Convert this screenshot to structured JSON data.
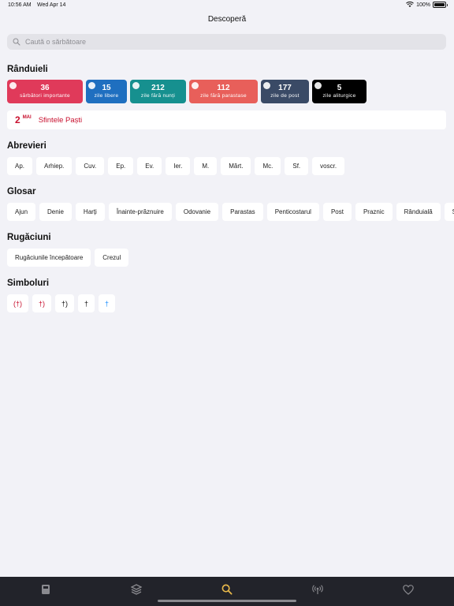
{
  "status_bar": {
    "time": "10:56 AM",
    "date": "Wed Apr 14",
    "battery": "100%"
  },
  "title": "Descoperă",
  "search": {
    "placeholder": "Caută o sărbătoare"
  },
  "randuieli": {
    "title": "Rânduieli",
    "cards": [
      {
        "count": "36",
        "label": "sărbători importante",
        "color": "#e03a5a"
      },
      {
        "count": "15",
        "label": "zile libere",
        "color": "#1f6fc0"
      },
      {
        "count": "212",
        "label": "zile fără nunți",
        "color": "#16908f"
      },
      {
        "count": "112",
        "label": "zile fără parastase",
        "color": "#e85f5a"
      },
      {
        "count": "177",
        "label": "zile de post",
        "color": "#3a4a66"
      },
      {
        "count": "5",
        "label": "zile aliturgice",
        "color": "#000000"
      }
    ]
  },
  "event": {
    "day": "2",
    "month": "MAI",
    "name": "Sfintele Paști",
    "color": "#c8102e"
  },
  "abrevieri": {
    "title": "Abrevieri",
    "items": [
      "Ap.",
      "Arhiep.",
      "Cuv.",
      "Ep.",
      "Ev.",
      "Ier.",
      "M.",
      "Mărt.",
      "Mc.",
      "Sf.",
      "voscr."
    ]
  },
  "glosar": {
    "title": "Glosar",
    "items": [
      "Ajun",
      "Denie",
      "Harți",
      "Înainte-prăznuire",
      "Odovanie",
      "Parastas",
      "Penticostarul",
      "Post",
      "Praznic",
      "Rânduială",
      "So"
    ]
  },
  "rugaciuni": {
    "title": "Rugăciuni",
    "items": [
      "Rugăciunile începătoare",
      "Crezul"
    ]
  },
  "simboluri": {
    "title": "Simboluri",
    "items": [
      {
        "symbol": "(†)",
        "color": "#c8102e"
      },
      {
        "symbol": "†)",
        "color": "#c8102e"
      },
      {
        "symbol": "†)",
        "color": "#111111"
      },
      {
        "symbol": "†",
        "color": "#111111"
      },
      {
        "symbol": "†",
        "color": "#1e90ff"
      }
    ]
  },
  "tab_bar": {
    "active_color": "#e8b84a",
    "inactive_color": "#8a8a8f",
    "tabs": [
      {
        "icon": "calendar-book-icon",
        "active": false
      },
      {
        "icon": "layers-icon",
        "active": false
      },
      {
        "icon": "search-icon",
        "active": true
      },
      {
        "icon": "broadcast-icon",
        "active": false
      },
      {
        "icon": "heart-icon",
        "active": false
      }
    ]
  }
}
